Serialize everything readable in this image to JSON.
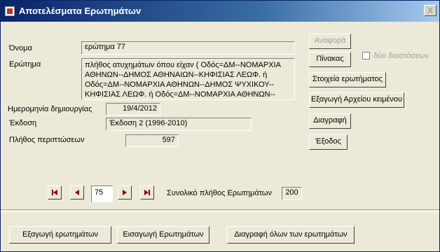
{
  "window": {
    "title": "Αποτελέσματα Ερωτημάτων",
    "close_glyph": "X"
  },
  "form": {
    "name_label": "Όνομα",
    "name_value": "ερώτημα 77",
    "query_label": "Ερώτημα",
    "query_value": "πλήθος ατυχημάτων  όπου είχαν  ( Οδός=ΔΜ--ΝΟΜΑΡΧΙΑ ΑΘΗΝΩΝ--ΔΗΜΟΣ ΑΘΗΝΑΙΩΝ--ΚΗΦΙΣΙΑΣ ΛΕΩΦ. ή Οδός=ΔΜ--ΝΟΜΑΡΧΙΑ ΑΘΗΝΩΝ--ΔΗΜΟΣ ΨΥΧΙΚΟΥ--ΚΗΦΙΣΙΑΣ ΛΕΩΦ. ή  Οδός=ΔΜ--ΝΟΜΑΡΧΙΑ ΑΘΗΝΩΝ--",
    "created_label": "Ημερομηνία δημιουργίας",
    "created_value": "19/4/2012",
    "edition_label": "Έκδοση",
    "edition_value": "Έκδοση 2 (1996-2010)",
    "cases_label": "Πλήθος περιπτώσεων",
    "cases_value": "597"
  },
  "buttons": {
    "report": "Αναφορά",
    "table": "Πίνακας",
    "two_dims": "δύο διαστάσεων",
    "query_info": "Στοιχεία ερωτήματος",
    "export_text": "Εξαγωγή Αρχείου κειμένου",
    "delete": "Διαγραφή",
    "exit": "Έξοδος"
  },
  "navigation": {
    "current_record": "75",
    "total_label": "Συνολικό πλήθος Ερωτημάτων",
    "total_value": "200"
  },
  "footer": {
    "export_queries": "Εξαγωγή ερωτημάτων",
    "import_queries": "Εισαγωγή Ερωτημάτων",
    "delete_all": "Διαγραφή όλων των ερωτημάτων"
  },
  "colors": {
    "nav_arrow": "#8b0000",
    "titlebar": "#0a246a"
  }
}
